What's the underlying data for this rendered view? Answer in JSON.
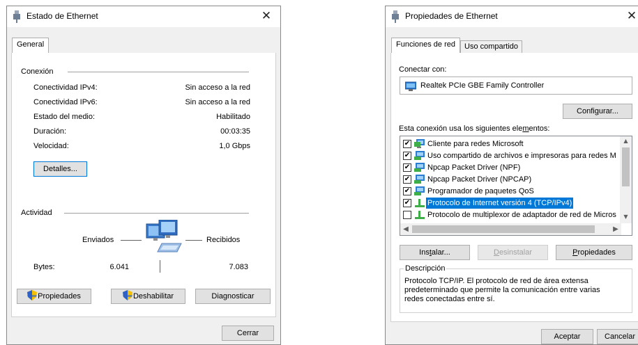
{
  "status_window": {
    "title": "Estado de Ethernet",
    "tab_general": "General",
    "connection_group": "Conexión",
    "rows": [
      {
        "label": "Conectividad IPv4:",
        "value": "Sin acceso a la red"
      },
      {
        "label": "Conectividad IPv6:",
        "value": "Sin acceso a la red"
      },
      {
        "label": "Estado del medio:",
        "value": "Habilitado"
      },
      {
        "label": "Duración:",
        "value": "00:03:35"
      },
      {
        "label": "Velocidad:",
        "value": "1,0 Gbps"
      }
    ],
    "details_button": "Detalles...",
    "activity_group": "Actividad",
    "sent_label": "Enviados",
    "received_label": "Recibidos",
    "bytes_label": "Bytes:",
    "bytes_sent": "6.041",
    "bytes_received": "7.083",
    "properties_button": "Propiedades",
    "disable_button": "Deshabilitar",
    "diagnose_button": "Diagnosticar",
    "close_button": "Cerrar"
  },
  "properties_window": {
    "title": "Propiedades de Ethernet",
    "tab_network": "Funciones de red",
    "tab_sharing": "Uso compartido",
    "connect_using_label": "Conectar con:",
    "adapter_name": "Realtek PCIe GBE Family Controller",
    "configure_button_pre": "Confi",
    "configure_button_u": "g",
    "configure_button_post": "urar...",
    "items_label_pre": "Esta conexión usa los siguientes ele",
    "items_label_u": "m",
    "items_label_post": "entos:",
    "items": [
      {
        "label": "Cliente para redes Microsoft",
        "checked": "✔"
      },
      {
        "label": "Uso compartido de archivos e impresoras para redes M",
        "checked": "✔"
      },
      {
        "label": "Npcap Packet Driver (NPF)",
        "checked": "✔"
      },
      {
        "label": "Npcap Packet Driver (NPCAP)",
        "checked": "✔"
      },
      {
        "label": "Programador de paquetes QoS",
        "checked": "✔"
      },
      {
        "label": "Protocolo de Internet versión 4 (TCP/IPv4)",
        "checked": "✔"
      },
      {
        "label": "Protocolo de multiplexor de adaptador de red de Micros",
        "checked": ""
      }
    ],
    "install_button_pre": "Ins",
    "install_button_u": "t",
    "install_button_post": "alar...",
    "uninstall_button_u": "D",
    "uninstall_button_post": "esinstalar",
    "properties_button_u": "P",
    "properties_button_post": "ropiedades",
    "description_group": "Descripción",
    "description_text": "Protocolo TCP/IP. El protocolo de red de área extensa predeterminado que permite la comunicación entre varias redes conectadas entre sí.",
    "accept_button": "Aceptar",
    "cancel_button": "Cancelar"
  },
  "colors": {
    "accent": "#0078d7",
    "window_bg": "#f0f0f0"
  }
}
